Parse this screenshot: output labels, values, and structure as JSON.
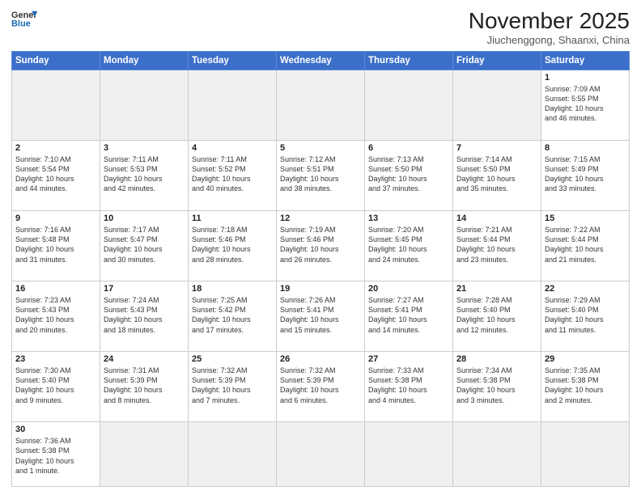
{
  "header": {
    "logo_general": "General",
    "logo_blue": "Blue",
    "month_title": "November 2025",
    "location": "Jiuchenggong, Shaanxi, China"
  },
  "days_of_week": [
    "Sunday",
    "Monday",
    "Tuesday",
    "Wednesday",
    "Thursday",
    "Friday",
    "Saturday"
  ],
  "weeks": [
    [
      {
        "day": "",
        "info": "",
        "empty": true
      },
      {
        "day": "",
        "info": "",
        "empty": true
      },
      {
        "day": "",
        "info": "",
        "empty": true
      },
      {
        "day": "",
        "info": "",
        "empty": true
      },
      {
        "day": "",
        "info": "",
        "empty": true
      },
      {
        "day": "",
        "info": "",
        "empty": true
      },
      {
        "day": "1",
        "info": "Sunrise: 7:09 AM\nSunset: 5:55 PM\nDaylight: 10 hours\nand 46 minutes."
      }
    ],
    [
      {
        "day": "2",
        "info": "Sunrise: 7:10 AM\nSunset: 5:54 PM\nDaylight: 10 hours\nand 44 minutes."
      },
      {
        "day": "3",
        "info": "Sunrise: 7:11 AM\nSunset: 5:53 PM\nDaylight: 10 hours\nand 42 minutes."
      },
      {
        "day": "4",
        "info": "Sunrise: 7:11 AM\nSunset: 5:52 PM\nDaylight: 10 hours\nand 40 minutes."
      },
      {
        "day": "5",
        "info": "Sunrise: 7:12 AM\nSunset: 5:51 PM\nDaylight: 10 hours\nand 38 minutes."
      },
      {
        "day": "6",
        "info": "Sunrise: 7:13 AM\nSunset: 5:50 PM\nDaylight: 10 hours\nand 37 minutes."
      },
      {
        "day": "7",
        "info": "Sunrise: 7:14 AM\nSunset: 5:50 PM\nDaylight: 10 hours\nand 35 minutes."
      },
      {
        "day": "8",
        "info": "Sunrise: 7:15 AM\nSunset: 5:49 PM\nDaylight: 10 hours\nand 33 minutes."
      }
    ],
    [
      {
        "day": "9",
        "info": "Sunrise: 7:16 AM\nSunset: 5:48 PM\nDaylight: 10 hours\nand 31 minutes."
      },
      {
        "day": "10",
        "info": "Sunrise: 7:17 AM\nSunset: 5:47 PM\nDaylight: 10 hours\nand 30 minutes."
      },
      {
        "day": "11",
        "info": "Sunrise: 7:18 AM\nSunset: 5:46 PM\nDaylight: 10 hours\nand 28 minutes."
      },
      {
        "day": "12",
        "info": "Sunrise: 7:19 AM\nSunset: 5:46 PM\nDaylight: 10 hours\nand 26 minutes."
      },
      {
        "day": "13",
        "info": "Sunrise: 7:20 AM\nSunset: 5:45 PM\nDaylight: 10 hours\nand 24 minutes."
      },
      {
        "day": "14",
        "info": "Sunrise: 7:21 AM\nSunset: 5:44 PM\nDaylight: 10 hours\nand 23 minutes."
      },
      {
        "day": "15",
        "info": "Sunrise: 7:22 AM\nSunset: 5:44 PM\nDaylight: 10 hours\nand 21 minutes."
      }
    ],
    [
      {
        "day": "16",
        "info": "Sunrise: 7:23 AM\nSunset: 5:43 PM\nDaylight: 10 hours\nand 20 minutes."
      },
      {
        "day": "17",
        "info": "Sunrise: 7:24 AM\nSunset: 5:43 PM\nDaylight: 10 hours\nand 18 minutes."
      },
      {
        "day": "18",
        "info": "Sunrise: 7:25 AM\nSunset: 5:42 PM\nDaylight: 10 hours\nand 17 minutes."
      },
      {
        "day": "19",
        "info": "Sunrise: 7:26 AM\nSunset: 5:41 PM\nDaylight: 10 hours\nand 15 minutes."
      },
      {
        "day": "20",
        "info": "Sunrise: 7:27 AM\nSunset: 5:41 PM\nDaylight: 10 hours\nand 14 minutes."
      },
      {
        "day": "21",
        "info": "Sunrise: 7:28 AM\nSunset: 5:40 PM\nDaylight: 10 hours\nand 12 minutes."
      },
      {
        "day": "22",
        "info": "Sunrise: 7:29 AM\nSunset: 5:40 PM\nDaylight: 10 hours\nand 11 minutes."
      }
    ],
    [
      {
        "day": "23",
        "info": "Sunrise: 7:30 AM\nSunset: 5:40 PM\nDaylight: 10 hours\nand 9 minutes."
      },
      {
        "day": "24",
        "info": "Sunrise: 7:31 AM\nSunset: 5:39 PM\nDaylight: 10 hours\nand 8 minutes."
      },
      {
        "day": "25",
        "info": "Sunrise: 7:32 AM\nSunset: 5:39 PM\nDaylight: 10 hours\nand 7 minutes."
      },
      {
        "day": "26",
        "info": "Sunrise: 7:32 AM\nSunset: 5:39 PM\nDaylight: 10 hours\nand 6 minutes."
      },
      {
        "day": "27",
        "info": "Sunrise: 7:33 AM\nSunset: 5:38 PM\nDaylight: 10 hours\nand 4 minutes."
      },
      {
        "day": "28",
        "info": "Sunrise: 7:34 AM\nSunset: 5:38 PM\nDaylight: 10 hours\nand 3 minutes."
      },
      {
        "day": "29",
        "info": "Sunrise: 7:35 AM\nSunset: 5:38 PM\nDaylight: 10 hours\nand 2 minutes."
      }
    ],
    [
      {
        "day": "30",
        "info": "Sunrise: 7:36 AM\nSunset: 5:38 PM\nDaylight: 10 hours\nand 1 minute.",
        "last": true
      },
      {
        "day": "",
        "info": "",
        "empty": true,
        "last": true
      },
      {
        "day": "",
        "info": "",
        "empty": true,
        "last": true
      },
      {
        "day": "",
        "info": "",
        "empty": true,
        "last": true
      },
      {
        "day": "",
        "info": "",
        "empty": true,
        "last": true
      },
      {
        "day": "",
        "info": "",
        "empty": true,
        "last": true
      },
      {
        "day": "",
        "info": "",
        "empty": true,
        "last": true
      }
    ]
  ]
}
